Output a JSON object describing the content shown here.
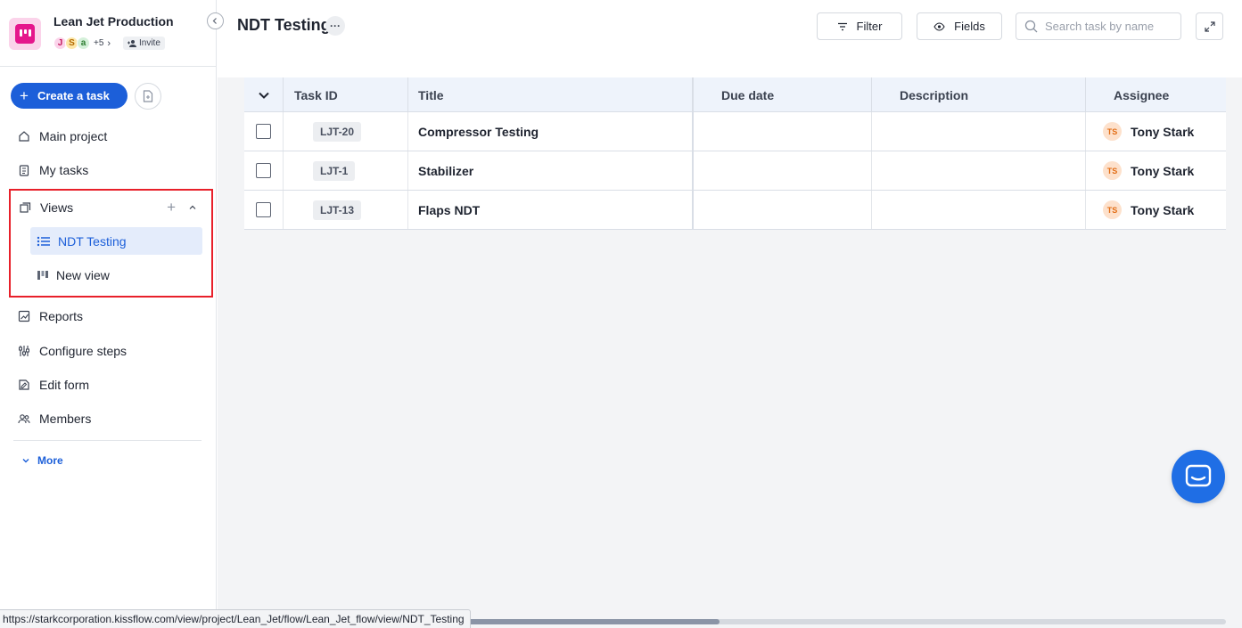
{
  "project": {
    "name": "Lean Jet Production",
    "brand_color": "#e5168c",
    "avatars": [
      {
        "letter": "J",
        "bg": "#fbd3ea",
        "fg": "#c2185b"
      },
      {
        "letter": "S",
        "bg": "#fde7a8",
        "fg": "#b26a00"
      },
      {
        "letter": "a",
        "bg": "#d4f0d9",
        "fg": "#2e7d32"
      }
    ],
    "more_count": "+5",
    "invite_label": "Invite"
  },
  "sidebar": {
    "create_label": "Create a task",
    "nav": [
      {
        "label": "Main project",
        "icon": "home-icon"
      },
      {
        "label": "My tasks",
        "icon": "clipboard-icon"
      }
    ],
    "views": {
      "label": "Views",
      "items": [
        {
          "label": "NDT Testing",
          "icon": "list-icon",
          "active": true
        },
        {
          "label": "New view",
          "icon": "board-icon",
          "active": false
        }
      ]
    },
    "nav_bottom": [
      {
        "label": "Reports",
        "icon": "chart-icon"
      },
      {
        "label": "Configure steps",
        "icon": "steps-icon"
      },
      {
        "label": "Edit form",
        "icon": "form-icon"
      },
      {
        "label": "Members",
        "icon": "members-icon"
      }
    ],
    "more_label": "More"
  },
  "header": {
    "title": "NDT Testing",
    "filter_label": "Filter",
    "fields_label": "Fields",
    "search_placeholder": "Search task by name"
  },
  "table": {
    "columns": [
      "Task ID",
      "Title",
      "Due date",
      "Description",
      "Assignee"
    ],
    "rows": [
      {
        "id": "LJT-20",
        "title": "Compressor Testing",
        "due": "",
        "description": "",
        "assignee": "Tony Stark",
        "initials": "TS"
      },
      {
        "id": "LJT-1",
        "title": "Stabilizer",
        "due": "",
        "description": "",
        "assignee": "Tony Stark",
        "initials": "TS"
      },
      {
        "id": "LJT-13",
        "title": "Flaps NDT",
        "due": "",
        "description": "",
        "assignee": "Tony Stark",
        "initials": "TS"
      }
    ]
  },
  "status_url": "https://starkcorporation.kissflow.com/view/project/Lean_Jet/flow/Lean_Jet_flow/view/NDT_Testing",
  "colors": {
    "accent": "#1c5fd9",
    "highlight_border": "#e8202a",
    "chat": "#1f6ee5"
  }
}
